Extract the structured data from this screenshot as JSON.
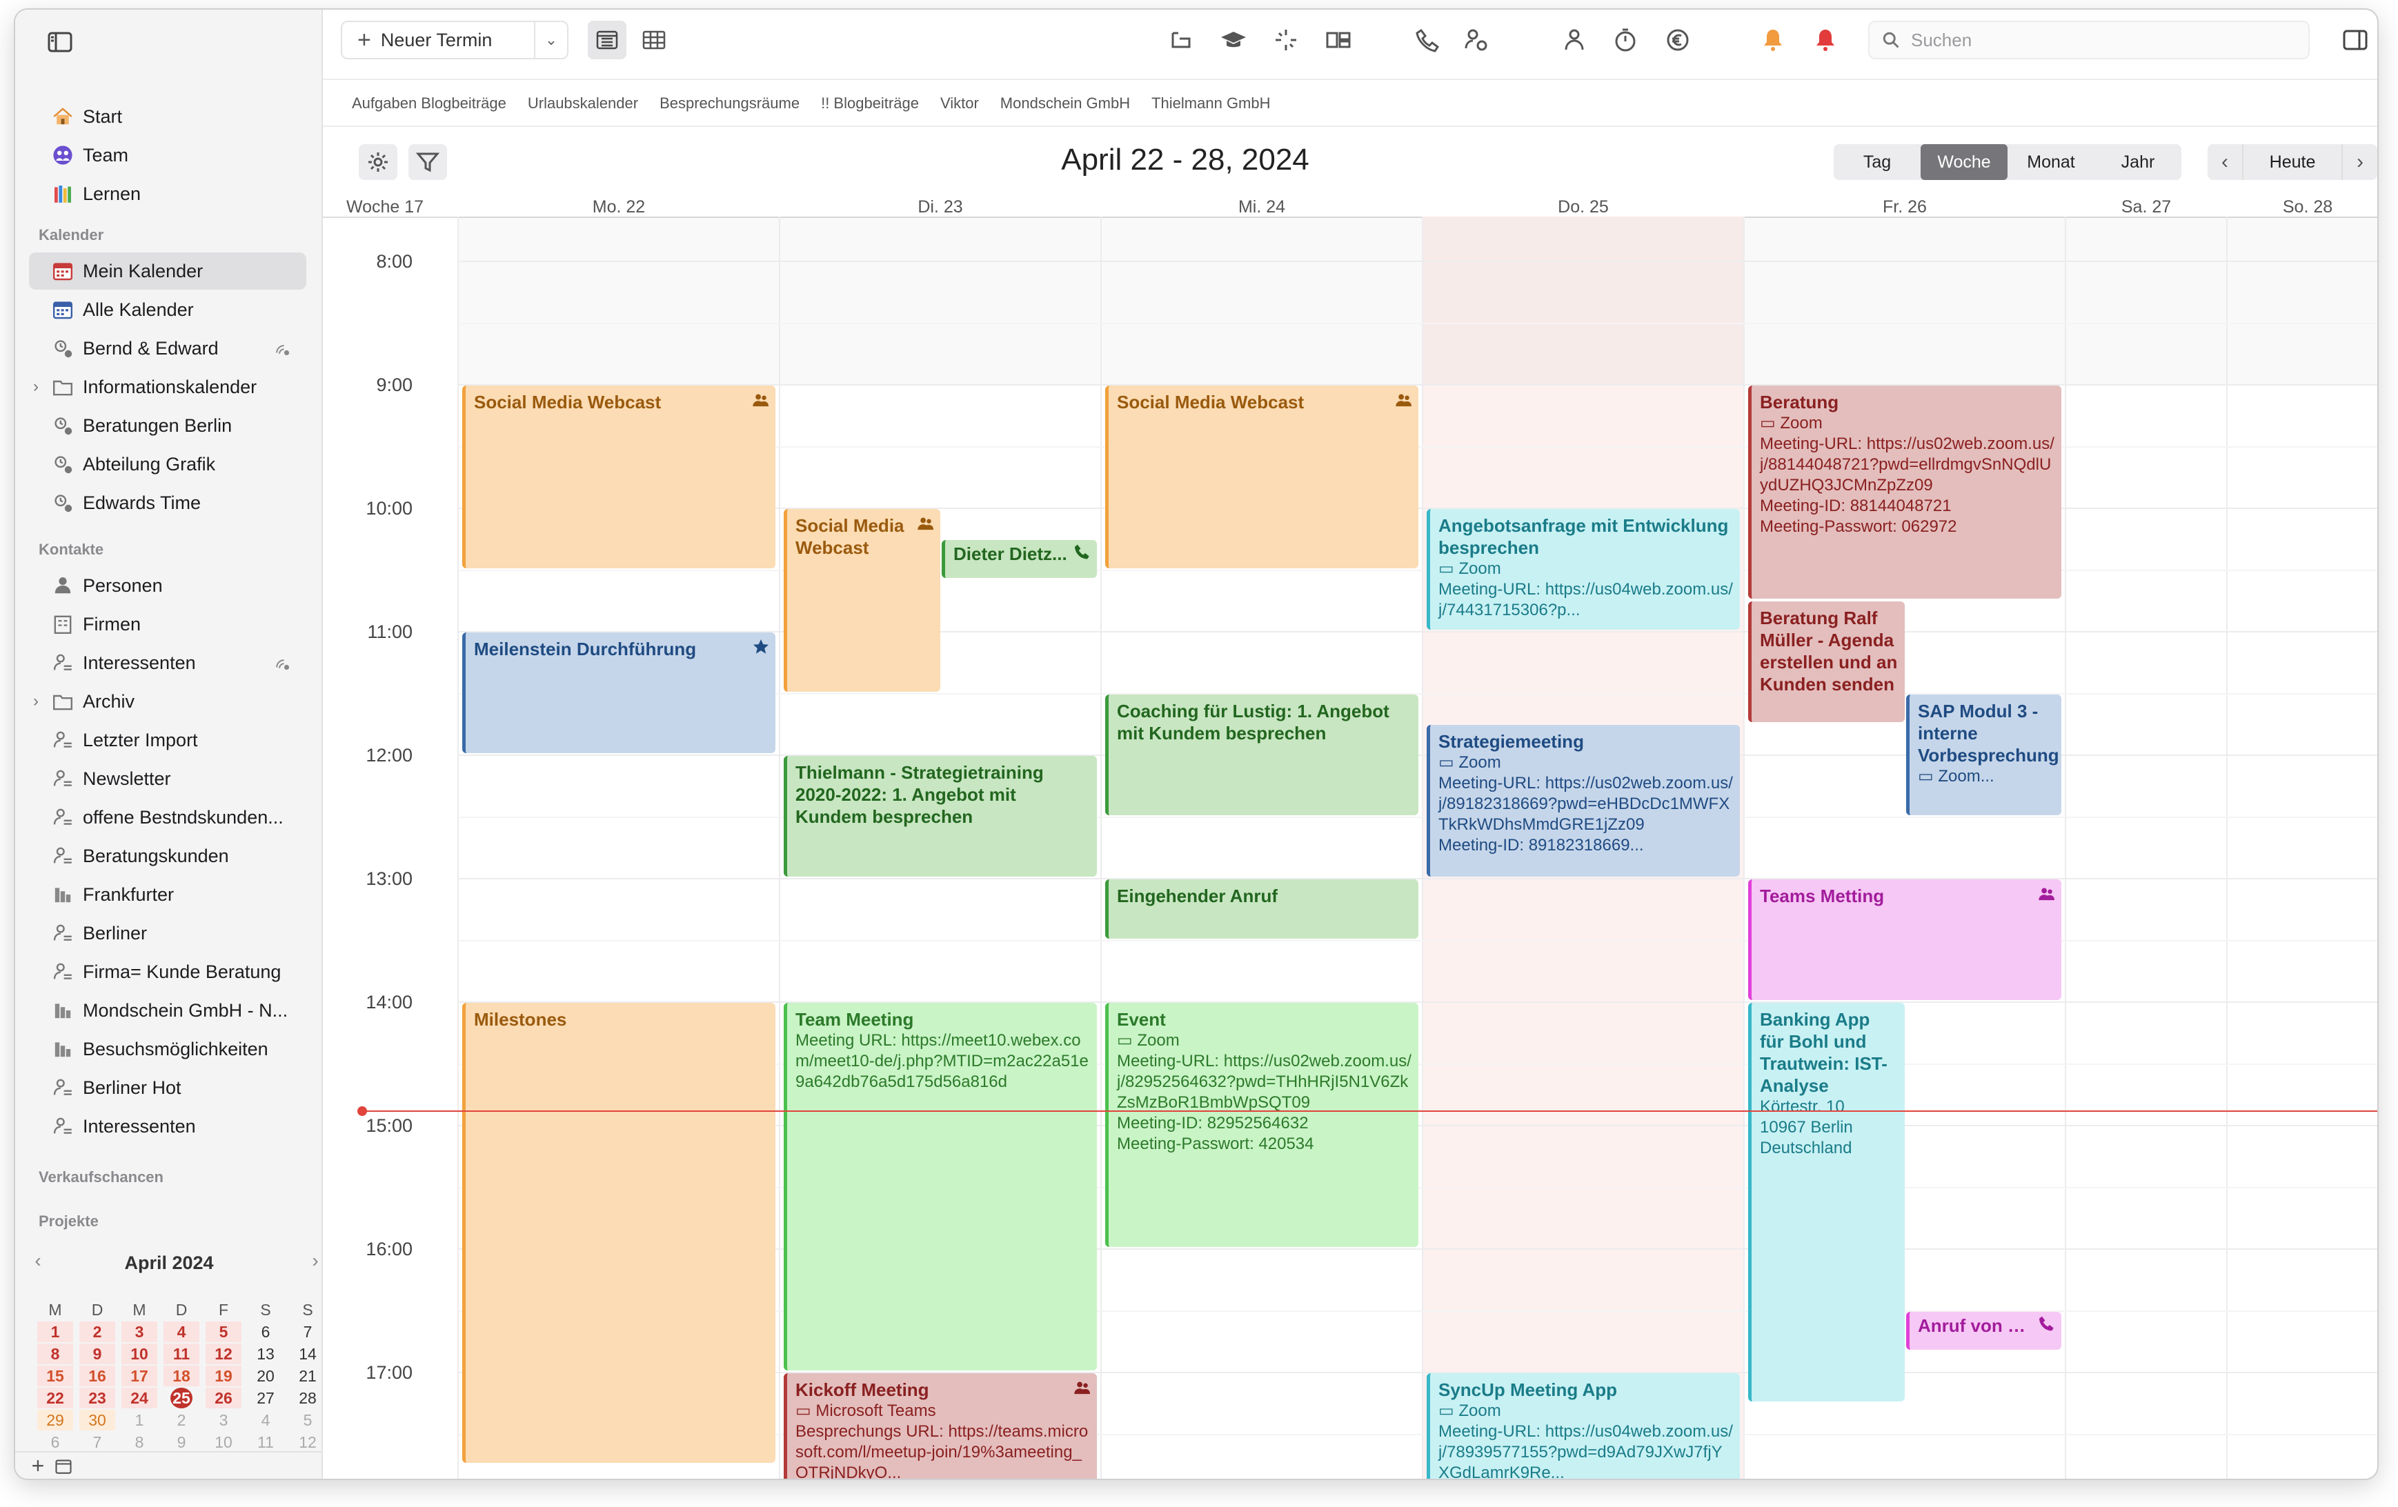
{
  "toolbar": {
    "new_event": "Neuer Termin",
    "search_placeholder": "Suchen"
  },
  "favorites": [
    "Aufgaben Blogbeiträge",
    "Urlaubskalender",
    "Besprechungsräume",
    "!! Blogbeiträge",
    "Viktor",
    "Mondschein GmbH",
    "Thielmann GmbH"
  ],
  "sidebar": {
    "top": [
      {
        "label": "Start"
      },
      {
        "label": "Team"
      },
      {
        "label": "Lernen"
      }
    ],
    "calendar_header": "Kalender",
    "calendars": [
      {
        "label": "Mein Kalender",
        "selected": true
      },
      {
        "label": "Alle Kalender"
      },
      {
        "label": "Bernd & Edward",
        "shared": true
      },
      {
        "label": "Informationskalender",
        "folder": true
      },
      {
        "label": "Beratungen Berlin"
      },
      {
        "label": "Abteilung Grafik"
      },
      {
        "label": "Edwards Time"
      }
    ],
    "contacts_header": "Kontakte",
    "contacts": [
      {
        "label": "Personen"
      },
      {
        "label": "Firmen"
      },
      {
        "label": "Interessenten",
        "shared": true
      },
      {
        "label": "Archiv",
        "folder": true
      },
      {
        "label": "Letzter Import"
      },
      {
        "label": "Newsletter"
      },
      {
        "label": "offene Bestndskunden..."
      },
      {
        "label": "Beratungskunden"
      },
      {
        "label": "Frankfurter"
      },
      {
        "label": "Berliner"
      },
      {
        "label": "Firma= Kunde Beratung"
      },
      {
        "label": "Mondschein GmbH - N..."
      },
      {
        "label": "Besuchsmöglichkeiten"
      },
      {
        "label": "Berliner Hot"
      },
      {
        "label": "Interessenten"
      }
    ],
    "opportunities_header": "Verkaufschancen",
    "projects_header": "Projekte"
  },
  "minical": {
    "title": "April 2024",
    "weekdays": [
      "M",
      "D",
      "M",
      "D",
      "F",
      "S",
      "S"
    ],
    "weeks": [
      [
        "1",
        "2",
        "3",
        "4",
        "5",
        "6",
        "7"
      ],
      [
        "8",
        "9",
        "10",
        "11",
        "12",
        "13",
        "14"
      ],
      [
        "15",
        "16",
        "17",
        "18",
        "19",
        "20",
        "21"
      ],
      [
        "22",
        "23",
        "24",
        "25",
        "26",
        "27",
        "28"
      ],
      [
        "29",
        "30",
        "1",
        "2",
        "3",
        "4",
        "5"
      ],
      [
        "6",
        "7",
        "8",
        "9",
        "10",
        "11",
        "12"
      ]
    ],
    "today": "25"
  },
  "view": {
    "title": "April 22 - 28, 2024",
    "modes": [
      "Tag",
      "Woche",
      "Monat",
      "Jahr"
    ],
    "active_mode": "Woche",
    "today_label": "Heute",
    "week_label": "Woche 17",
    "days": [
      "Mo. 22",
      "Di. 23",
      "Mi. 24",
      "Do. 25",
      "Fr. 26",
      "Sa. 27",
      "So. 28"
    ],
    "hours": [
      "8:00",
      "9:00",
      "10:00",
      "11:00",
      "12:00",
      "13:00",
      "14:00",
      "15:00",
      "16:00",
      "17:00"
    ],
    "current_time": "14:53"
  },
  "colors": {
    "orange": "#f2a13c",
    "blue": "#3a6aa8",
    "green": "#3b9a3b",
    "lightgreen": "#4cc04c",
    "cyan": "#36b8c8",
    "red": "#b33a3a",
    "pink": "#e040d8",
    "today_bg": "#fdf1f0",
    "now_line": "#e0443c"
  },
  "events": [
    {
      "day": 0,
      "start": "9:00",
      "end": "10:30",
      "title": "Social Media Webcast",
      "theme": "orange",
      "badge": "people"
    },
    {
      "day": 0,
      "start": "11:00",
      "end": "12:00",
      "title": "Meilenstein Durchführung",
      "theme": "blue",
      "badge": "star"
    },
    {
      "day": 0,
      "start": "14:00",
      "end": "17:45",
      "title": "Milestones",
      "theme": "orange"
    },
    {
      "day": 1,
      "start": "10:00",
      "end": "11:30",
      "title": "Social Media Webcast",
      "theme": "orange",
      "badge": "people",
      "half": "left"
    },
    {
      "day": 1,
      "start": "10:15",
      "end": "10:35",
      "title": "Dieter Dietz...",
      "theme": "green",
      "badge": "phone",
      "half": "right"
    },
    {
      "day": 1,
      "start": "12:00",
      "end": "13:00",
      "title": "Thielmann - Strategietraining 2020-2022: 1. Angebot mit Kundem besprechen",
      "theme": "green"
    },
    {
      "day": 1,
      "start": "14:00",
      "end": "17:00",
      "title": "Team Meeting",
      "detail": "Meeting URL: https://meet10.webex.com/meet10-de/j.php?MTID=m2ac22a51e9a642db76a5d175d56a816d",
      "theme": "lightgreen"
    },
    {
      "day": 1,
      "start": "17:00",
      "end": "18:00",
      "title": "Kickoff Meeting",
      "detail": "▭ Microsoft Teams\nBesprechungs URL: https://teams.microsoft.com/l/meetup-join/19%3ameeting_OTRjNDkyO...",
      "theme": "red",
      "badge": "people"
    },
    {
      "day": 2,
      "start": "9:00",
      "end": "10:30",
      "title": "Social Media Webcast",
      "theme": "orange",
      "badge": "people"
    },
    {
      "day": 2,
      "start": "11:30",
      "end": "12:30",
      "title": "Coaching für Lustig: 1. Angebot mit Kundem besprechen",
      "theme": "green"
    },
    {
      "day": 2,
      "start": "13:00",
      "end": "13:30",
      "title": "Eingehender Anruf",
      "theme": "green"
    },
    {
      "day": 2,
      "start": "14:00",
      "end": "16:00",
      "title": "Event",
      "detail": "▭ Zoom\nMeeting-URL: https://us02web.zoom.us/j/82952564632?pwd=THhHRjI5N1V6ZkZsMzBoR1BmbWpSQT09\nMeeting-ID: 82952564632\nMeeting-Passwort: 420534",
      "theme": "lightgreen"
    },
    {
      "day": 3,
      "start": "10:00",
      "end": "11:00",
      "title": "Angebotsanfrage mit Entwicklung besprechen",
      "detail": "▭ Zoom\nMeeting-URL: https://us04web.zoom.us/j/74431715306?p...",
      "theme": "cyan"
    },
    {
      "day": 3,
      "start": "11:45",
      "end": "13:00",
      "title": "Strategiemeeting",
      "detail": "▭ Zoom\nMeeting-URL: https://us02web.zoom.us/j/89182318669?pwd=eHBDcDc1MWFXTkRkWDhsMmdGRE1jZz09\nMeeting-ID: 89182318669...",
      "theme": "blue"
    },
    {
      "day": 3,
      "start": "17:00",
      "end": "18:00",
      "title": "SyncUp Meeting App",
      "detail": "▭ Zoom\nMeeting-URL: https://us04web.zoom.us/j/78939577155?pwd=d9Ad79JXwJ7fjYXGdLamrK9Re...",
      "theme": "cyan"
    },
    {
      "day": 4,
      "start": "9:00",
      "end": "10:45",
      "title": "Beratung",
      "detail": "▭ Zoom\nMeeting-URL: https://us02web.zoom.us/j/88144048721?pwd=ellrdmgvSnNQdlUydUZHQ3JCMnZpZz09\nMeeting-ID: 88144048721\nMeeting-Passwort: 062972",
      "theme": "red"
    },
    {
      "day": 4,
      "start": "10:45",
      "end": "11:45",
      "title": "Beratung Ralf Müller - Agenda erstellen und an Kunden senden",
      "theme": "red",
      "half": "left"
    },
    {
      "day": 4,
      "start": "11:30",
      "end": "12:30",
      "title": "SAP Modul 3 - interne Vorbesprechung",
      "detail": "▭ Zoom...",
      "theme": "blue",
      "half": "right"
    },
    {
      "day": 4,
      "start": "13:00",
      "end": "14:00",
      "title": "Teams Metting",
      "theme": "pink",
      "badge": "people"
    },
    {
      "day": 4,
      "start": "14:00",
      "end": "17:15",
      "title": "Banking App für Bohl und Trautwein: IST-Analyse",
      "detail": "Körtestr. 10\n10967 Berlin\nDeutschland",
      "theme": "cyan",
      "half": "left-wide"
    },
    {
      "day": 4,
      "start": "16:30",
      "end": "16:50",
      "title": "Anruf von B...",
      "theme": "pink",
      "badge": "phone",
      "half": "right"
    }
  ]
}
